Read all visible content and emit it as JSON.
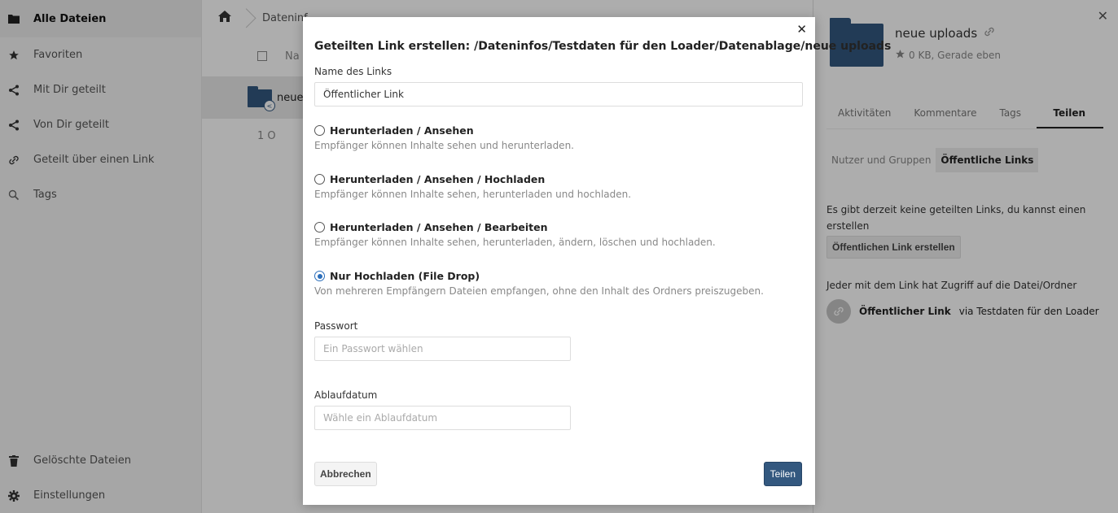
{
  "sidebar": {
    "items": [
      {
        "label": "Alle Dateien",
        "icon": "folder-icon"
      },
      {
        "label": "Favoriten",
        "icon": "star-icon"
      },
      {
        "label": "Mit Dir geteilt",
        "icon": "share-icon"
      },
      {
        "label": "Von Dir geteilt",
        "icon": "share-icon"
      },
      {
        "label": "Geteilt über einen Link",
        "icon": "link-icon"
      },
      {
        "label": "Tags",
        "icon": "search-icon"
      }
    ],
    "bottom": [
      {
        "label": "Gelöschte Dateien",
        "icon": "trash-icon"
      },
      {
        "label": "Einstellungen",
        "icon": "gear-icon"
      }
    ]
  },
  "main": {
    "breadcrumb_first": "Dateninf",
    "header_name": "Na",
    "file_name": "neue",
    "summary": "1 O"
  },
  "details": {
    "title": "neue uploads",
    "meta": "0 KB, Gerade eben",
    "tabs": [
      "Aktivitäten",
      "Kommentare",
      "Tags",
      "Teilen"
    ],
    "subtabs": [
      "Nutzer und Gruppen",
      "Öffentliche Links"
    ],
    "no_links": "Es gibt derzeit keine geteilten Links, du kannst einen erstellen",
    "create_link": "Öffentlichen Link erstellen",
    "anyone": "Jeder mit dem Link hat Zugriff auf die Datei/Ordner",
    "link_name": "Öffentlicher Link",
    "link_via": "via Testdaten für den Loader"
  },
  "modal": {
    "title": "Geteilten Link erstellen: /Dateninfos/Testdaten für den Loader/Datenablage/neue uploads",
    "name_label": "Name des Links",
    "name_value": "Öffentlicher Link",
    "options": [
      {
        "label": "Herunterladen / Ansehen",
        "desc": "Empfänger können Inhalte sehen und herunterladen.",
        "checked": false
      },
      {
        "label": "Herunterladen / Ansehen / Hochladen",
        "desc": "Empfänger können Inhalte sehen, herunterladen und hochladen.",
        "checked": false
      },
      {
        "label": "Herunterladen / Ansehen / Bearbeiten",
        "desc": "Empfänger können Inhalte sehen, herunterladen, ändern, löschen und hochladen.",
        "checked": false
      },
      {
        "label": "Nur Hochladen (File Drop)",
        "desc": "Von mehreren Empfängern Dateien empfangen, ohne den Inhalt des Ordners preiszugeben.",
        "checked": true
      }
    ],
    "password_label": "Passwort",
    "password_placeholder": "Ein Passwort wählen",
    "expiry_label": "Ablaufdatum",
    "expiry_placeholder": "Wähle ein Ablaufdatum",
    "cancel": "Abbrechen",
    "share": "Teilen"
  },
  "colors": {
    "accent": "#33587f",
    "radio": "#2a6ebb"
  }
}
